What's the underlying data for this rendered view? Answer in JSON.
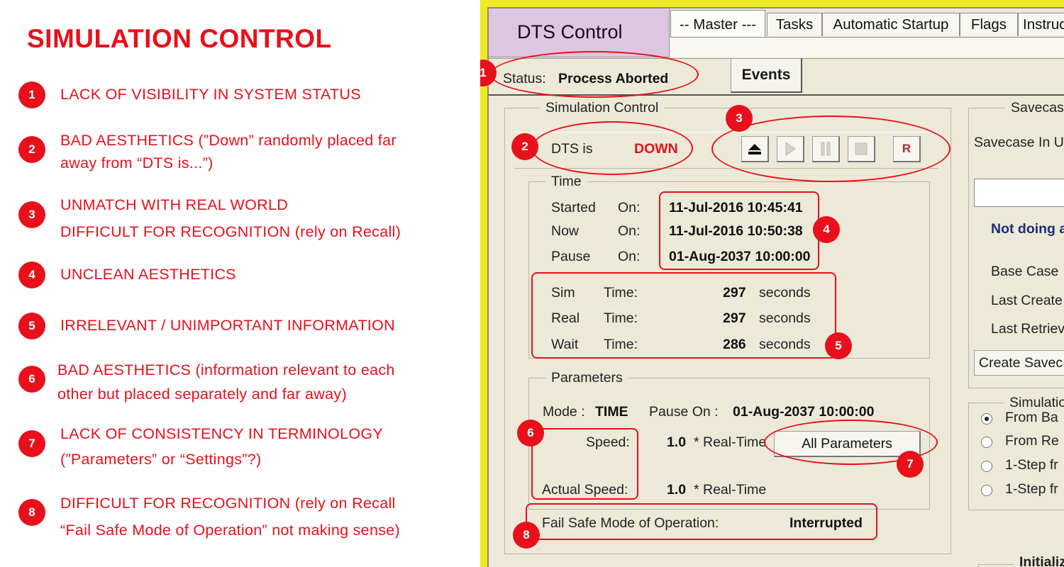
{
  "left": {
    "title": "SIMULATION CONTROL",
    "issues": [
      {
        "num": "1",
        "lines": [
          "LACK OF VISIBILITY IN SYSTEM STATUS"
        ]
      },
      {
        "num": "2",
        "lines": [
          "BAD AESTHETICS (”Down” randomly placed far",
          "away from “DTS is...”)"
        ]
      },
      {
        "num": "3",
        "lines": [
          "UNMATCH WITH REAL WORLD",
          "DIFFICULT FOR RECOGNITION (rely on Recall)"
        ]
      },
      {
        "num": "4",
        "lines": [
          "UNCLEAN AESTHETICS"
        ]
      },
      {
        "num": "5",
        "lines": [
          "IRRELEVANT / UNIMPORTANT INFORMATION"
        ]
      },
      {
        "num": "6",
        "lines": [
          "BAD AESTHETICS (information relevant to each",
          "other but placed separately and far away)"
        ]
      },
      {
        "num": "7",
        "lines": [
          "LACK OF CONSISTENCY IN TERMINOLOGY",
          "(”Parameters” or “Settings”?)"
        ]
      },
      {
        "num": "8",
        "lines": [
          "DIFFICULT FOR RECOGNITION (rely on Recall",
          "“Fail Safe Mode of Operation” not making sense)"
        ]
      }
    ]
  },
  "app": {
    "title": "DTS Control",
    "tabs": [
      "-- Master ---",
      "Tasks",
      "Automatic Startup",
      "Flags",
      "Instruc"
    ],
    "status_label": "Status:",
    "status_value": "Process Aborted",
    "events_button": "Events"
  },
  "sim_control": {
    "group_label": "Simulation Control",
    "dts_label": "DTS is",
    "dts_state": "DOWN",
    "dts_state_color": "#e8101b",
    "toolbar_icons": [
      "eject-icon",
      "play-icon",
      "pause-icon",
      "stop-icon",
      "record-icon"
    ],
    "record_label": "R",
    "time": {
      "group_label": "Time",
      "rows": [
        {
          "label": "Started",
          "on": "On:",
          "value": "11-Jul-2016 10:45:41"
        },
        {
          "label": "Now",
          "on": "On:",
          "value": "11-Jul-2016 10:50:38"
        },
        {
          "label": "Pause",
          "on": "On:",
          "value": "01-Aug-2037 10:00:00"
        }
      ],
      "durations": [
        {
          "label": "Sim",
          "time": "Time:",
          "value": "297",
          "unit": "seconds"
        },
        {
          "label": "Real",
          "time": "Time:",
          "value": "297",
          "unit": "seconds"
        },
        {
          "label": "Wait",
          "time": "Time:",
          "value": "286",
          "unit": "seconds"
        }
      ]
    },
    "parameters": {
      "group_label": "Parameters",
      "mode_label": "Mode :",
      "mode_value": "TIME",
      "pause_label": "Pause On :",
      "pause_value": "01-Aug-2037 10:00:00",
      "speed_label": "Speed:",
      "speed_value": "1.0",
      "speed_unit": "* Real-Time",
      "all_params_button": "All Parameters",
      "actual_speed_label": "Actual Speed:",
      "actual_speed_value": "1.0",
      "actual_speed_unit": "* Real-Time"
    },
    "fail_safe_label": "Fail Safe Mode of Operation:",
    "fail_safe_value": "Interrupted"
  },
  "savecase": {
    "group_label": "Savecas",
    "in_use_label": "Savecase In U",
    "status": "Not doing a",
    "base_case": "Base Case",
    "last_created": "Last Create",
    "last_retrieved": "Last Retriev",
    "create_button": "Create Savec"
  },
  "simulation_mode": {
    "group_label": "Simulatio",
    "options": [
      "From Ba",
      "From Re",
      "1-Step fr",
      "1-Step fr"
    ],
    "selected_index": 0
  },
  "initialize": {
    "group_label": "Initializ"
  }
}
